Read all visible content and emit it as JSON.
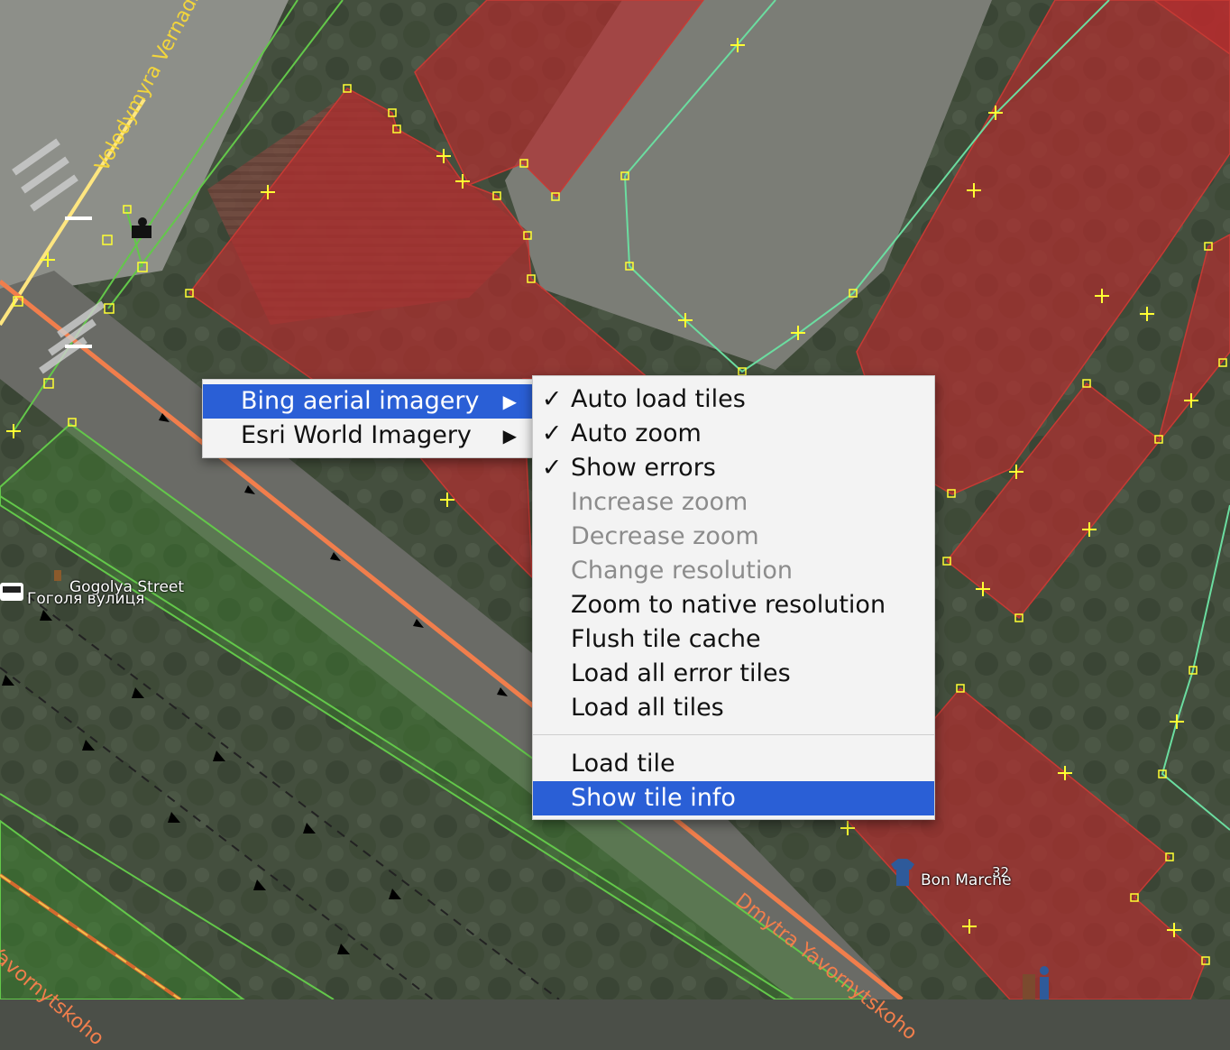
{
  "map": {
    "street_labels": {
      "vernadskoho": "Volodymyra Vernadskoho",
      "gogolya_en": "Gogolya Street",
      "gogolya_uk": "Гоголя вулиця",
      "yavornytskoho_top": "Dmytra Yavornytskoho",
      "yavornytskoho_left": "Yavornytskoho"
    },
    "poi_labels": {
      "bon_marche": "Bon Marche",
      "house_number": "32"
    },
    "icons": [
      "bus-stop-icon",
      "parking-icon",
      "clothes-shop-icon",
      "toilets-icon",
      "camera-icon",
      "bench-icon"
    ],
    "colors": {
      "building_fill": "#b62c2e",
      "park_fill": "#3f8f2f",
      "road_primary": "#f17e4c",
      "road_outline": "#63c84a",
      "path": "#6bdda0",
      "node": "#ffff33"
    }
  },
  "imagery_menu": {
    "items": [
      {
        "label": "Bing aerial imagery",
        "has_submenu": true,
        "selected": true
      },
      {
        "label": "Esri World Imagery",
        "has_submenu": true,
        "selected": false
      }
    ],
    "arrow_glyph": "▶"
  },
  "submenu": {
    "check_glyph": "✓",
    "items": [
      {
        "label": "Auto load tiles",
        "checked": true,
        "enabled": true
      },
      {
        "label": "Auto zoom",
        "checked": true,
        "enabled": true
      },
      {
        "label": "Show errors",
        "checked": true,
        "enabled": true
      },
      {
        "label": "Increase zoom",
        "checked": false,
        "enabled": false
      },
      {
        "label": "Decrease zoom",
        "checked": false,
        "enabled": false
      },
      {
        "label": "Change resolution",
        "checked": false,
        "enabled": false
      },
      {
        "label": "Zoom to native resolution",
        "checked": false,
        "enabled": true
      },
      {
        "label": "Flush tile cache",
        "checked": false,
        "enabled": true
      },
      {
        "label": "Load all error tiles",
        "checked": false,
        "enabled": true
      },
      {
        "label": "Load all tiles",
        "checked": false,
        "enabled": true
      },
      {
        "label": "Load tile",
        "checked": false,
        "enabled": true
      },
      {
        "label": "Show tile info",
        "checked": false,
        "enabled": true,
        "selected": true
      }
    ]
  }
}
